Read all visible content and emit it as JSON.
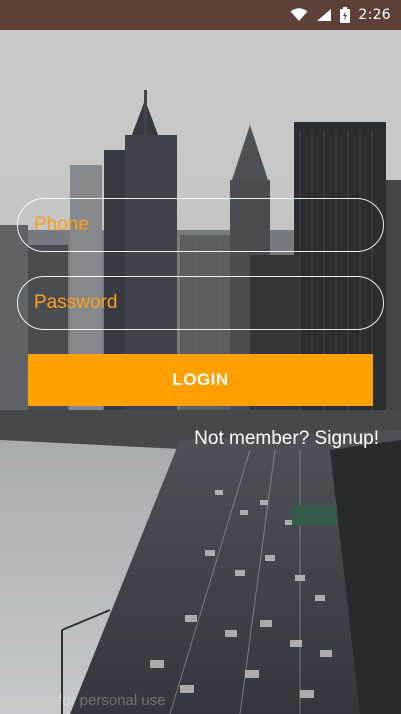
{
  "status_bar": {
    "time": "2:26",
    "icons": [
      "wifi-icon",
      "signal-icon",
      "battery-icon"
    ]
  },
  "form": {
    "phone_placeholder": "Phone",
    "password_placeholder": "Password",
    "login_label": "LOGIN",
    "signup_label": "Not member? Signup!"
  },
  "background": {
    "watermark_text": "for personal use"
  },
  "colors": {
    "status_bar": "#5d4037",
    "accent": "#ffa000",
    "placeholder": "#ff9f1a"
  }
}
